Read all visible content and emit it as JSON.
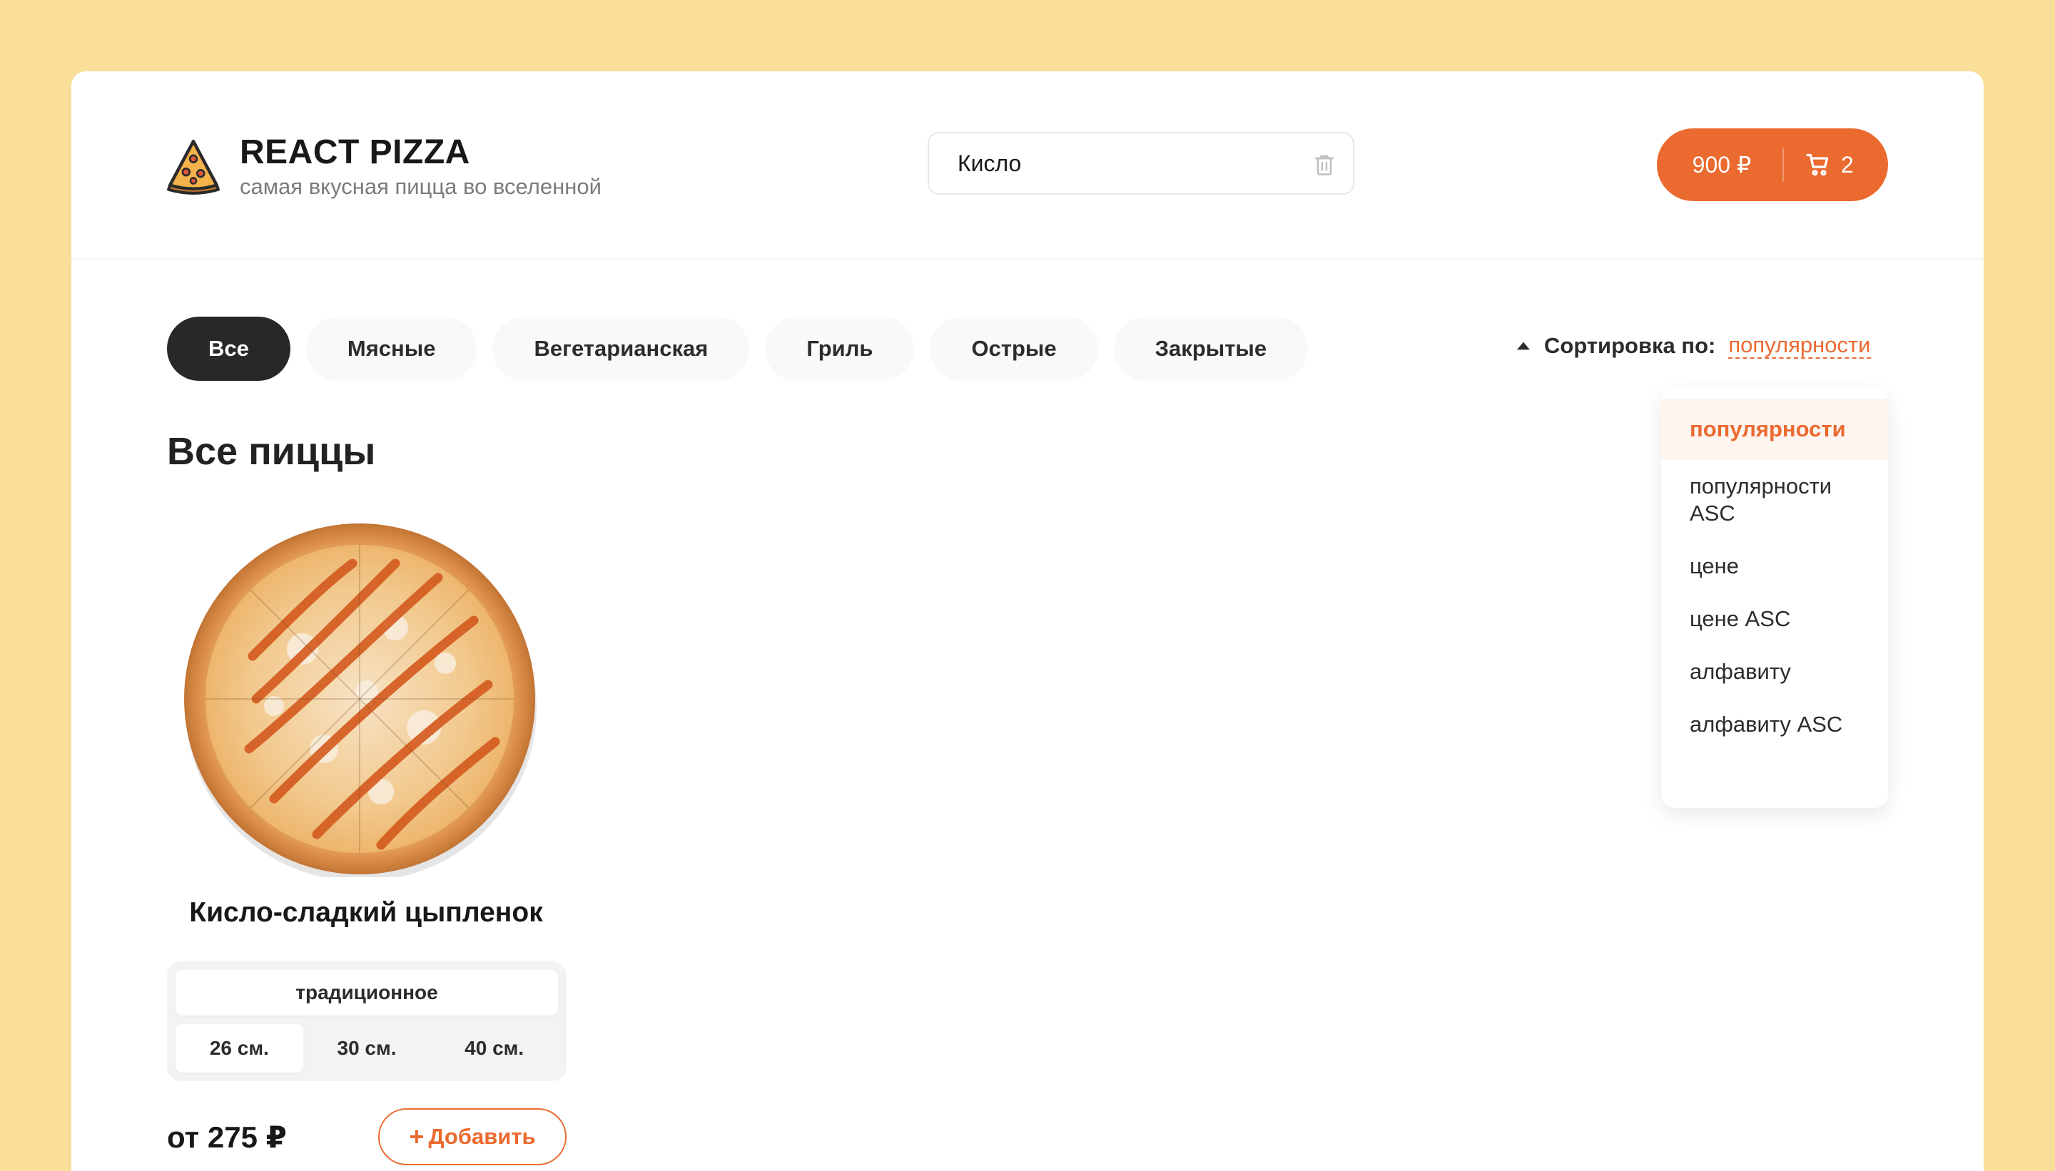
{
  "header": {
    "title": "REACT PIZZA",
    "subtitle": "самая вкусная пицца во вселенной",
    "search_value": "Кисло",
    "cart_price": "900 ₽",
    "cart_count": "2"
  },
  "categories": [
    "Все",
    "Мясные",
    "Вегетарианская",
    "Гриль",
    "Острые",
    "Закрытые"
  ],
  "active_category": "Все",
  "sort": {
    "label": "Сортировка по:",
    "value": "популярности",
    "options": [
      "популярности",
      "популярности ASC",
      "цене",
      "цене ASC",
      "алфавиту",
      "алфавиту ASC"
    ]
  },
  "content": {
    "title": "Все пиццы"
  },
  "pizza": {
    "name": "Кисло-сладкий цыпленок",
    "types": [
      "традиционное"
    ],
    "sizes": [
      "26 см.",
      "30 см.",
      "40 см."
    ],
    "active_size": "26 см.",
    "price": "от 275 ₽",
    "add_label": "Добавить"
  },
  "colors": {
    "background": "#F9DF99",
    "accent": "#EB6A2F",
    "active_category": "#282828"
  },
  "icons": [
    "pizza-logo-icon",
    "trash-icon",
    "cart-icon",
    "sort-arrow-icon",
    "plus-icon"
  ]
}
